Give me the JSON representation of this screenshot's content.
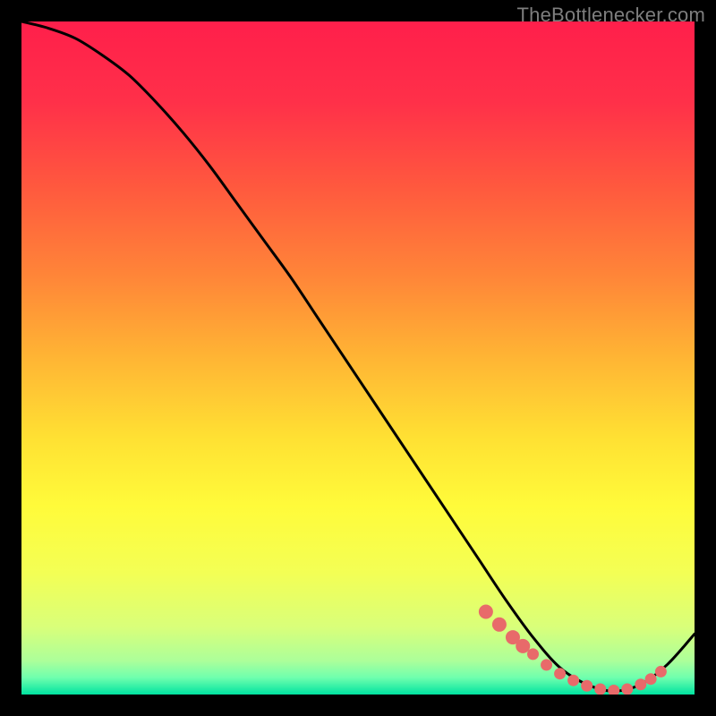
{
  "attribution": "TheBottlenecker.com",
  "colors": {
    "curve_stroke": "#000000",
    "marker_fill": "#e86a6a",
    "gradient_stops": [
      {
        "offset": 0.0,
        "color": "#ff1f4b"
      },
      {
        "offset": 0.12,
        "color": "#ff3049"
      },
      {
        "offset": 0.25,
        "color": "#ff5a3e"
      },
      {
        "offset": 0.38,
        "color": "#ff8638"
      },
      {
        "offset": 0.5,
        "color": "#ffb534"
      },
      {
        "offset": 0.62,
        "color": "#ffe133"
      },
      {
        "offset": 0.72,
        "color": "#fffb3a"
      },
      {
        "offset": 0.82,
        "color": "#f3ff55"
      },
      {
        "offset": 0.9,
        "color": "#d9ff7a"
      },
      {
        "offset": 0.95,
        "color": "#acff9a"
      },
      {
        "offset": 0.975,
        "color": "#6fffae"
      },
      {
        "offset": 1.0,
        "color": "#00e3a0"
      }
    ]
  },
  "chart_data": {
    "type": "line",
    "title": "",
    "xlabel": "",
    "ylabel": "",
    "xlim": [
      0,
      100
    ],
    "ylim": [
      0,
      100
    ],
    "legend": false,
    "grid": false,
    "series": [
      {
        "name": "curve",
        "x": [
          0,
          4,
          8,
          12,
          16,
          20,
          24,
          28,
          32,
          36,
          40,
          44,
          48,
          52,
          56,
          60,
          64,
          68,
          72,
          76,
          80,
          84,
          88,
          92,
          96,
          100
        ],
        "y": [
          100,
          99,
          97.5,
          95,
          92,
          88,
          83.5,
          78.5,
          73,
          67.5,
          62,
          56,
          50,
          44,
          38,
          32,
          26,
          20,
          14,
          8.5,
          4,
          1.5,
          0.5,
          1.5,
          4.5,
          9
        ]
      }
    ],
    "markers": {
      "name": "highlight-points",
      "x": [
        69,
        71,
        73,
        74.5,
        76,
        78,
        80,
        82,
        84,
        86,
        88,
        90,
        92,
        93.5,
        95
      ],
      "y": [
        12.3,
        10.4,
        8.5,
        7.2,
        6.0,
        4.4,
        3.1,
        2.1,
        1.3,
        0.8,
        0.6,
        0.8,
        1.5,
        2.3,
        3.4
      ]
    }
  }
}
